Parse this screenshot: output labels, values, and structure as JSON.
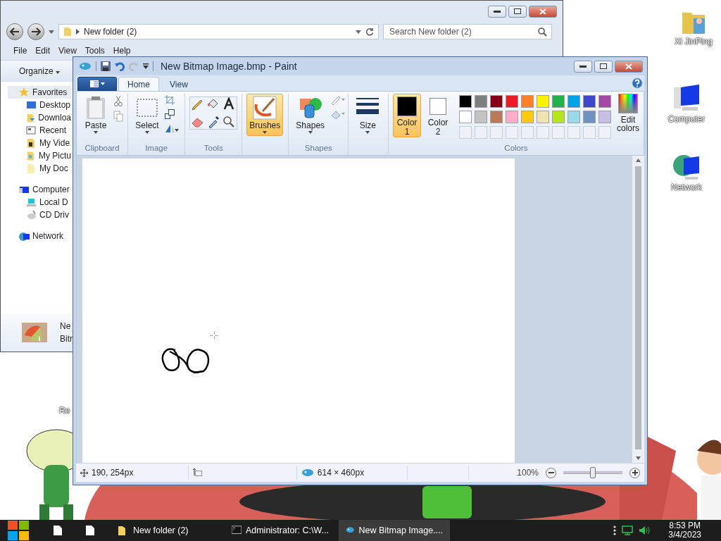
{
  "desktop": {
    "icons": [
      {
        "label": "Xi JinPing"
      },
      {
        "label": "Computer"
      },
      {
        "label": "Network"
      },
      {
        "label": "Re"
      }
    ]
  },
  "explorer": {
    "address": "New folder (2)",
    "search": {
      "placeholder": "Search New folder (2)"
    },
    "menu": [
      "File",
      "Edit",
      "View",
      "Tools",
      "Help"
    ],
    "organize": "Organize",
    "nav": [
      {
        "label": "Favorites",
        "selected": true,
        "children": [
          {
            "label": "Desktop",
            "selected": false
          },
          {
            "label": "Downloa",
            "selected": false
          },
          {
            "label": "Recent",
            "selected": false
          },
          {
            "label": "My Vide",
            "selected": false
          },
          {
            "label": "My Pictu",
            "selected": false
          },
          {
            "label": "My Doc",
            "selected": false
          }
        ]
      },
      {
        "label": "Computer",
        "selected": false,
        "children": [
          {
            "label": "Local D",
            "selected": false
          },
          {
            "label": "CD Driv",
            "selected": false
          }
        ]
      },
      {
        "label": "Network",
        "selected": false
      }
    ],
    "details": {
      "kind": "picture",
      "name": "Ne",
      "type": "Bitr"
    }
  },
  "paint": {
    "title": "New Bitmap Image.bmp - Paint",
    "tabs": [
      {
        "label": "Home",
        "selected": true
      },
      {
        "label": "View",
        "selected": false
      }
    ],
    "clipboard": {
      "label": "Clipboard",
      "paste": "Paste"
    },
    "image": {
      "label": "Image",
      "select": "Select"
    },
    "tools": {
      "label": "Tools",
      "items": [
        {
          "selected": false
        },
        {
          "selected": false
        },
        {
          "selected": false
        },
        {
          "selected": false
        },
        {
          "selected": false
        },
        {
          "selected": false
        }
      ]
    },
    "brushes": {
      "label": "Brushes",
      "selected": true
    },
    "shapes": {
      "label": "Shapes",
      "button": "Shapes"
    },
    "size": {
      "label": "Size"
    },
    "colors": {
      "label": "Colors",
      "color1": {
        "label": "Color",
        "num": "1",
        "color": "#000000",
        "selected": true
      },
      "color2": {
        "label": "Color",
        "num": "2",
        "color": "#ffffff",
        "selected": false
      },
      "edit": "Edit colors",
      "palette": [
        {
          "kind": "color",
          "color": "#000000"
        },
        {
          "kind": "color",
          "color": "#7f7f7f"
        },
        {
          "kind": "color",
          "color": "#880015"
        },
        {
          "kind": "color",
          "color": "#ed1c24"
        },
        {
          "kind": "color",
          "color": "#ff7f27"
        },
        {
          "kind": "color",
          "color": "#fff200"
        },
        {
          "kind": "color",
          "color": "#22b14c"
        },
        {
          "kind": "color",
          "color": "#00a2e8"
        },
        {
          "kind": "color",
          "color": "#3f48cc"
        },
        {
          "kind": "color",
          "color": "#a349a4"
        },
        {
          "kind": "color",
          "color": "#ffffff"
        },
        {
          "kind": "color",
          "color": "#c3c3c3"
        },
        {
          "kind": "color",
          "color": "#b97a57"
        },
        {
          "kind": "color",
          "color": "#ffaec9"
        },
        {
          "kind": "color",
          "color": "#ffc90e"
        },
        {
          "kind": "color",
          "color": "#efe4b0"
        },
        {
          "kind": "color",
          "color": "#b5e61d"
        },
        {
          "kind": "color",
          "color": "#99d9ea"
        },
        {
          "kind": "color",
          "color": "#7092be"
        },
        {
          "kind": "color",
          "color": "#c8bfe7"
        },
        {
          "kind": "empty"
        },
        {
          "kind": "empty"
        },
        {
          "kind": "empty"
        },
        {
          "kind": "empty"
        },
        {
          "kind": "empty"
        },
        {
          "kind": "empty"
        },
        {
          "kind": "empty"
        },
        {
          "kind": "empty"
        },
        {
          "kind": "empty"
        },
        {
          "kind": "empty"
        }
      ]
    },
    "status": {
      "position": "190, 254px",
      "size": "614 × 460px",
      "zoom": "100%",
      "zoom_slider": {
        "level": 0.5
      }
    }
  },
  "taskbar": {
    "tasks": [
      {
        "label": "New folder (2)",
        "selected": false
      },
      {
        "label": "Administrator: C:\\W...",
        "selected": false
      },
      {
        "label": "New Bitmap Image....",
        "selected": true
      }
    ],
    "time": "8:53 PM",
    "date": "3/4/2023"
  }
}
